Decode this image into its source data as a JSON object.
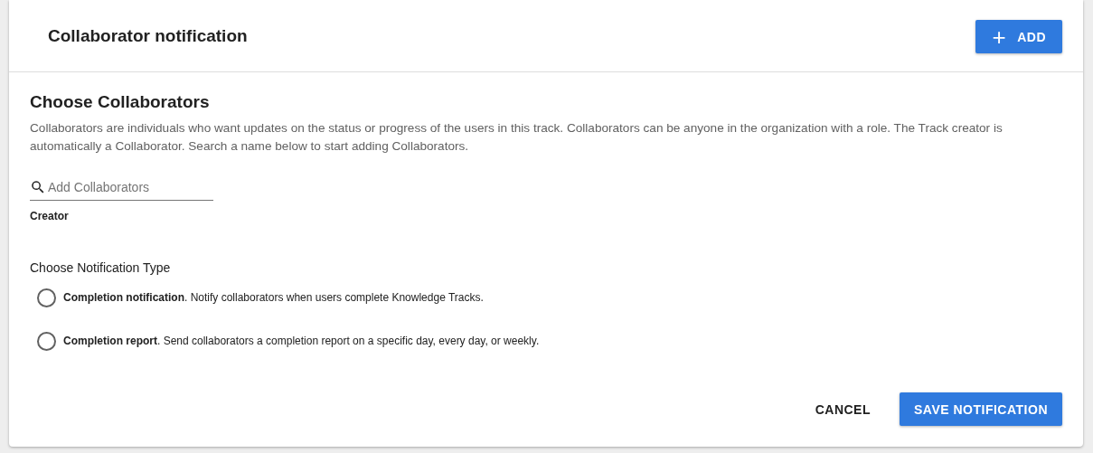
{
  "header": {
    "title": "Collaborator notification",
    "add_button": {
      "icon": "+",
      "label": "ADD"
    }
  },
  "collaborators": {
    "heading": "Choose Collaborators",
    "description": "Collaborators are individuals who want updates on the status or progress of the users in this track. Collaborators can be anyone in the organization with a role. The Track creator is automatically a Collaborator. Search a name below to start adding Collaborators.",
    "search": {
      "placeholder": "Add Collaborators"
    },
    "creator_label": "Creator"
  },
  "notification_type": {
    "heading": "Choose Notification Type",
    "options": [
      {
        "label": "**Completion notification**. Notify collaborators when users complete Knowledge Tracks.",
        "selected": false
      },
      {
        "label": "**Completion report**. Send collaborators a completion report on a specific day, every day, or weekly.",
        "selected": false
      }
    ]
  },
  "buttons": [
    {
      "kind": "text",
      "label": "CANCEL"
    },
    {
      "kind": "primary",
      "label": "SAVE NOTIFICATION"
    }
  ]
}
